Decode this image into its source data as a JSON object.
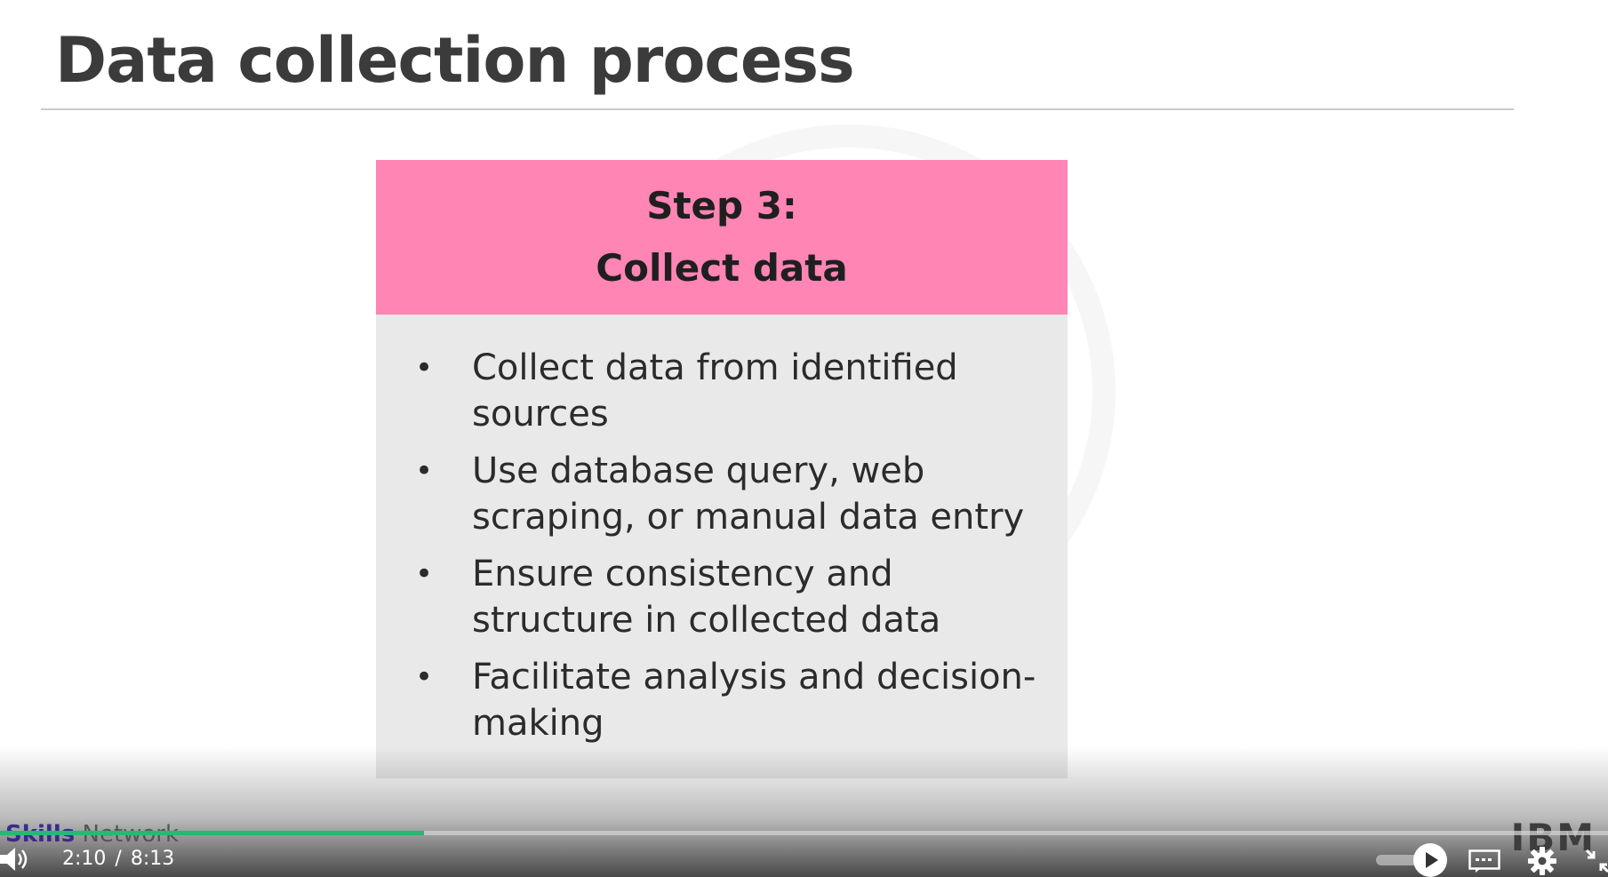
{
  "slide": {
    "title": "Data collection process",
    "card": {
      "header_line1": "Step 3:",
      "header_line2": "Collect data",
      "bullets": [
        "Collect data from identified sources",
        "Use database query, web scraping, or manual data entry",
        "Ensure consistency and structure in collected data",
        "Facilitate analysis and decision-making"
      ]
    },
    "brand_left": {
      "part1": "Skills",
      "part2": " Network"
    },
    "brand_right": "IBM"
  },
  "player": {
    "current_time": "2:10",
    "separator": "/",
    "duration": "8:13",
    "progress_fraction": 0.2637
  },
  "colors": {
    "header": "#ff85b5",
    "card_body": "#e9e9e9",
    "progress": "#2bb673"
  },
  "icons": [
    "volume-icon",
    "play-icon",
    "captions-icon",
    "gear-icon",
    "fullscreen-exit-icon"
  ]
}
